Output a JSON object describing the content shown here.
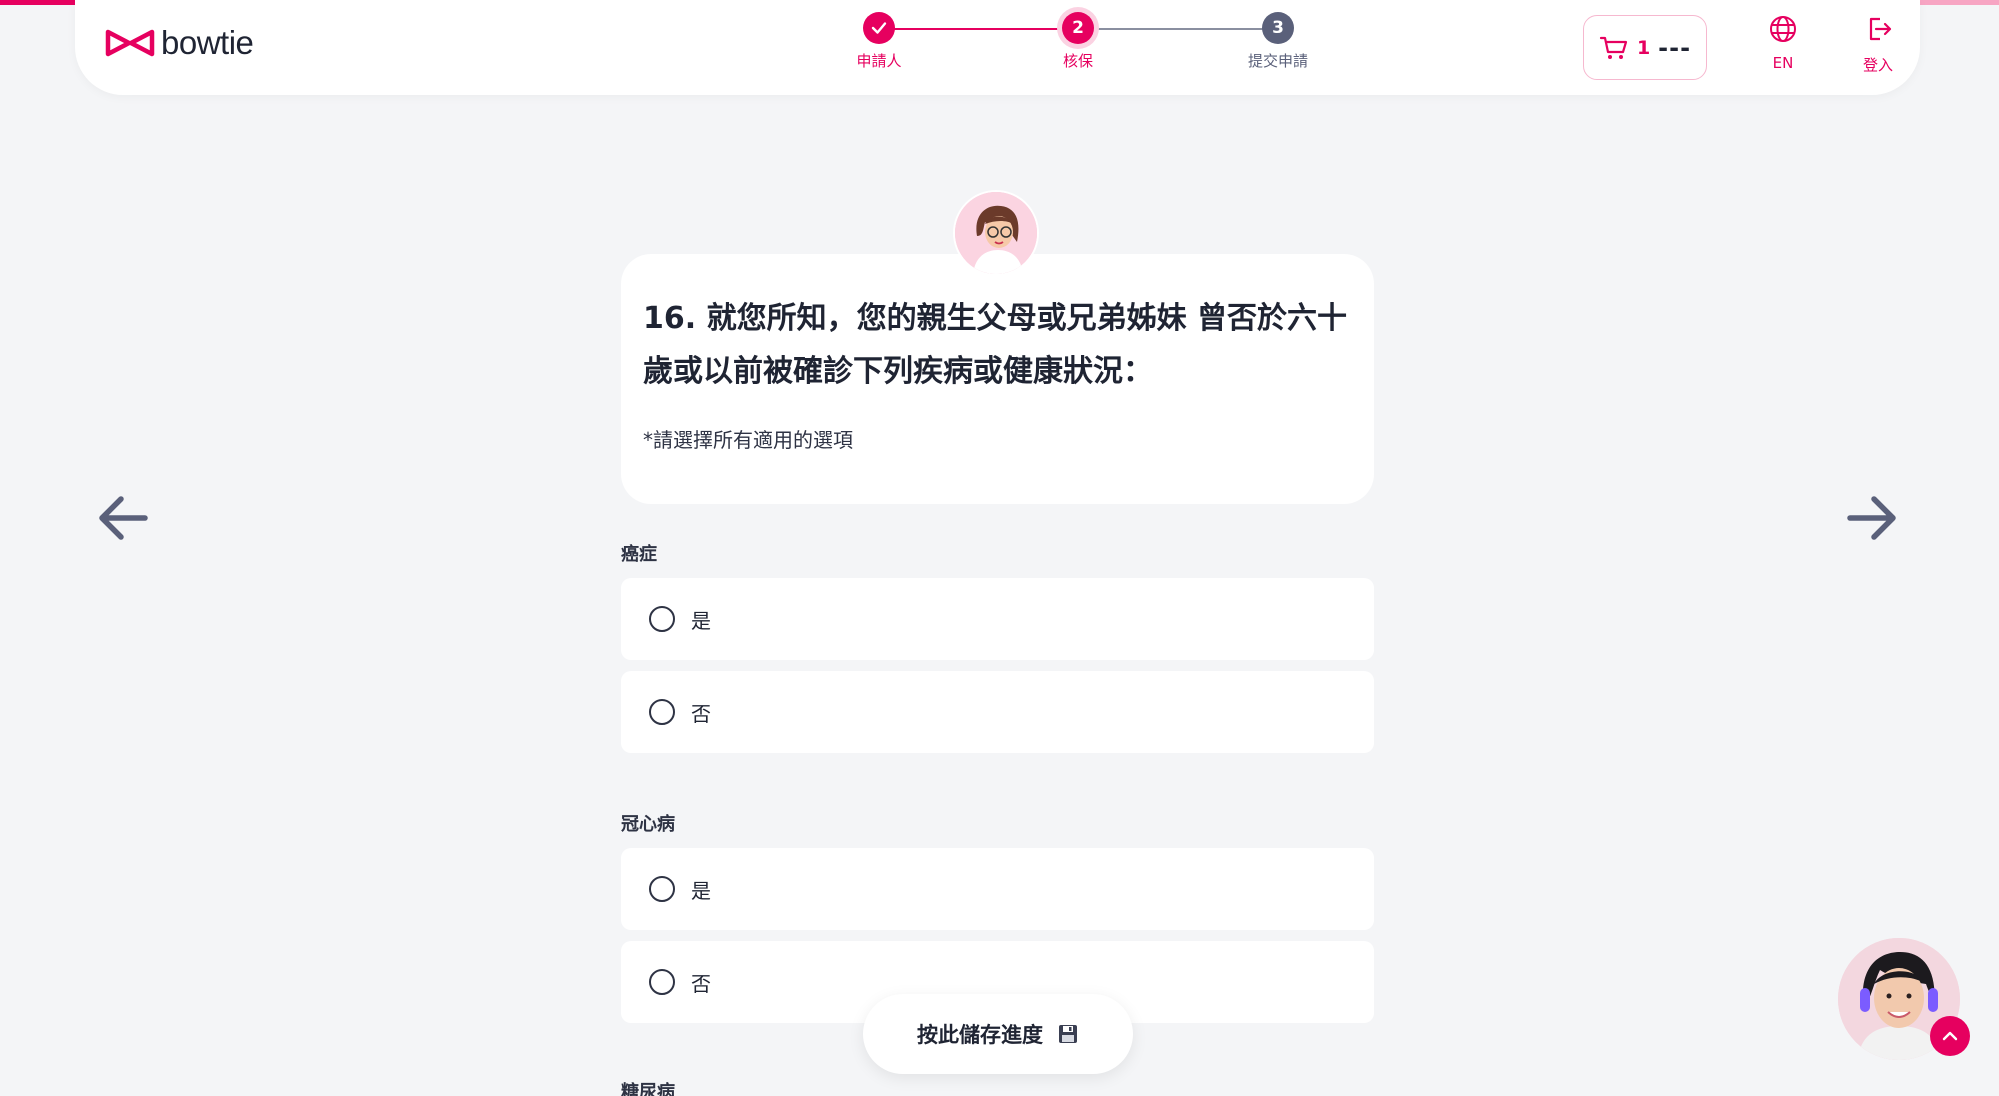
{
  "brand": {
    "name": "bowtie",
    "accent": "#e6005f"
  },
  "stepper": {
    "steps": [
      {
        "number": "",
        "label": "申請人",
        "state": "done"
      },
      {
        "number": "2",
        "label": "核保",
        "state": "current"
      },
      {
        "number": "3",
        "label": "提交申請",
        "state": "todo"
      }
    ]
  },
  "header": {
    "cart": {
      "count": "1",
      "total": "---"
    },
    "language": {
      "label": "EN",
      "icon": "globe-icon"
    },
    "login": {
      "label": "登入",
      "icon": "logout-icon"
    }
  },
  "question": {
    "title": "16. 就您所知，您的親生父母或兄弟姊妹 曾否於六十歲或以前被確診下列疾病或健康狀況：",
    "hint": "*請選擇所有適用的選項"
  },
  "sections": [
    {
      "label": "癌症",
      "options": [
        "是",
        "否"
      ]
    },
    {
      "label": "冠心病",
      "options": [
        "是",
        "否"
      ]
    },
    {
      "label": "糖尿病",
      "options": []
    }
  ],
  "save_button": {
    "label": "按此儲存進度",
    "icon": "floppy-disk-icon"
  }
}
